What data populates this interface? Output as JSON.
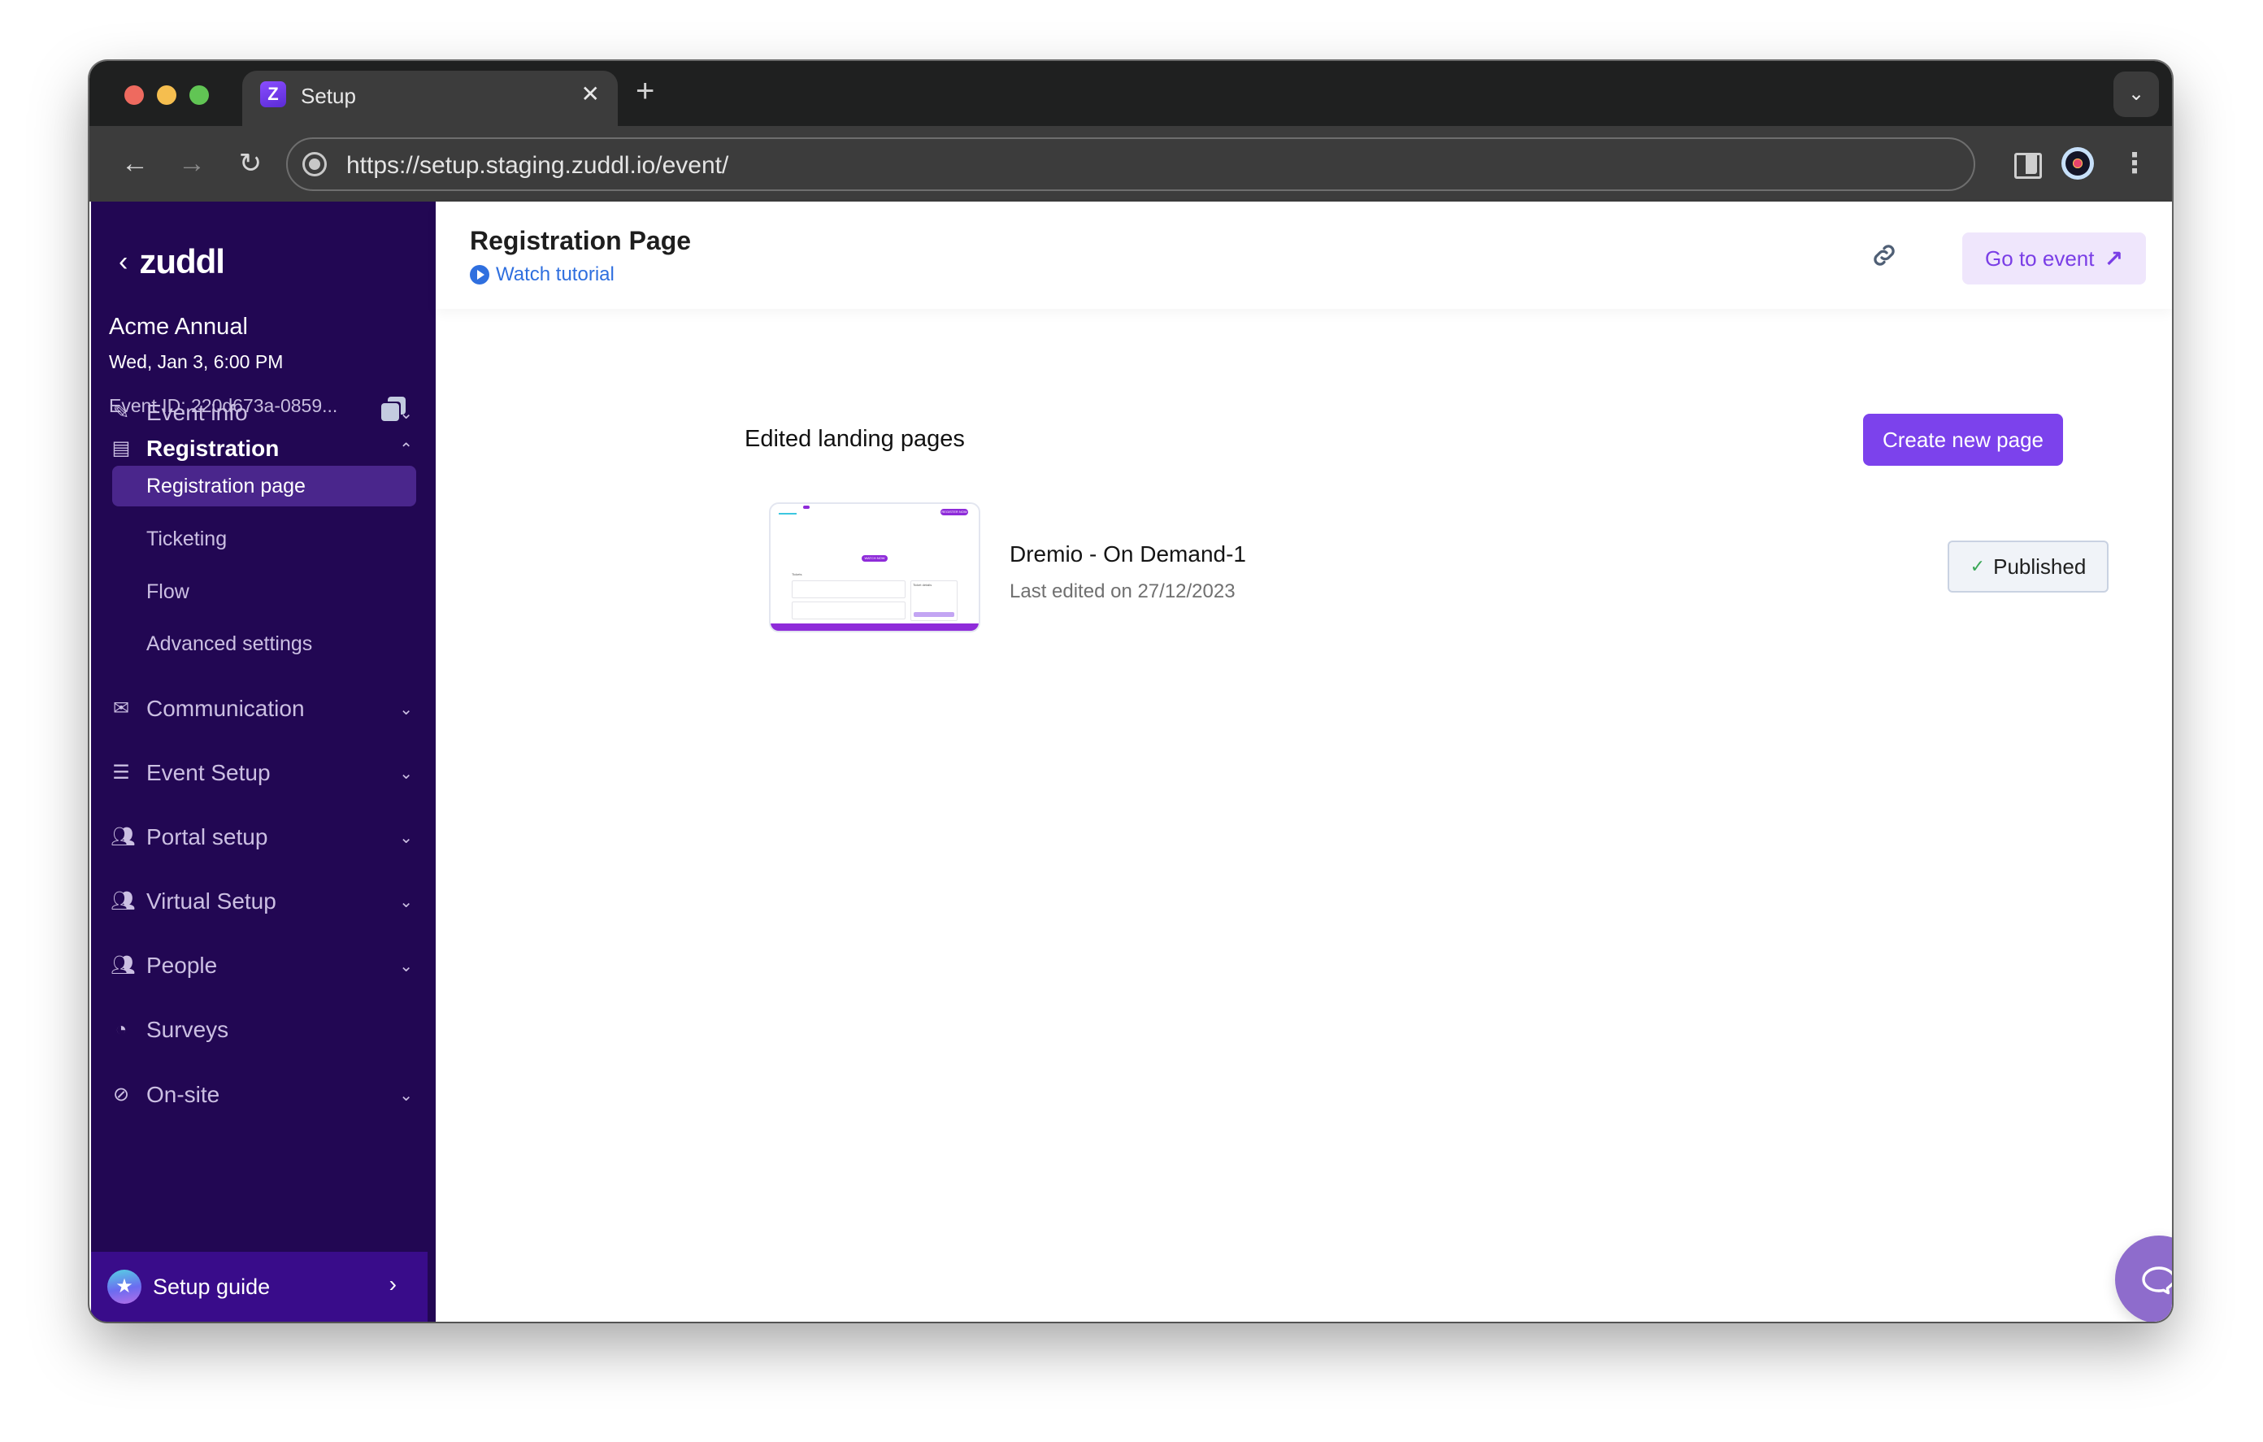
{
  "browser": {
    "tab_title": "Setup",
    "tab_favicon_letter": "Z",
    "url": "https://setup.staging.zuddl.io/event/"
  },
  "sidebar": {
    "brand": "zuddl",
    "event_name": "Acme Annual",
    "event_datetime": "Wed, Jan 3, 6:00 PM",
    "event_id": "Event ID: 220d673a-0859...",
    "nav": [
      {
        "label": "Event info",
        "icon": "magic-wand-icon",
        "expanded": false
      },
      {
        "label": "Registration",
        "icon": "form-icon",
        "expanded": true,
        "children": [
          {
            "label": "Registration page",
            "active": true
          },
          {
            "label": "Ticketing",
            "active": false
          },
          {
            "label": "Flow",
            "active": false
          },
          {
            "label": "Advanced settings",
            "active": false
          }
        ]
      },
      {
        "label": "Communication",
        "icon": "mail-icon",
        "expanded": false
      },
      {
        "label": "Event Setup",
        "icon": "signpost-icon",
        "expanded": false
      },
      {
        "label": "Portal setup",
        "icon": "users-icon",
        "expanded": false
      },
      {
        "label": "Virtual Setup",
        "icon": "users-icon",
        "expanded": false
      },
      {
        "label": "People",
        "icon": "users-icon",
        "expanded": false
      },
      {
        "label": "Surveys",
        "icon": "pie-chart-icon"
      },
      {
        "label": "On-site",
        "icon": "compass-icon",
        "expanded": false
      }
    ],
    "setup_guide": "Setup guide"
  },
  "header": {
    "title": "Registration Page",
    "tutorial_link": "Watch tutorial",
    "go_to_event": "Go to event"
  },
  "content": {
    "section_title": "Edited landing pages",
    "create_button": "Create new page",
    "pages": [
      {
        "name": "Dremio - On Demand-1",
        "last_edited": "Last edited on 27/12/2023",
        "status": "Published",
        "thumbnail": {
          "register_label": "REGISTER NOW",
          "watch_label": "WATCH NOW",
          "tickets_label": "Tickets",
          "ticket_details_label": "Ticket details"
        }
      }
    ]
  },
  "colors": {
    "sidebar_bg": "#220753",
    "accent": "#7c42ec",
    "active_nav": "#4a268c",
    "link": "#2f6fdf",
    "highlight": "#e8452c",
    "published_check": "#3aa757"
  }
}
